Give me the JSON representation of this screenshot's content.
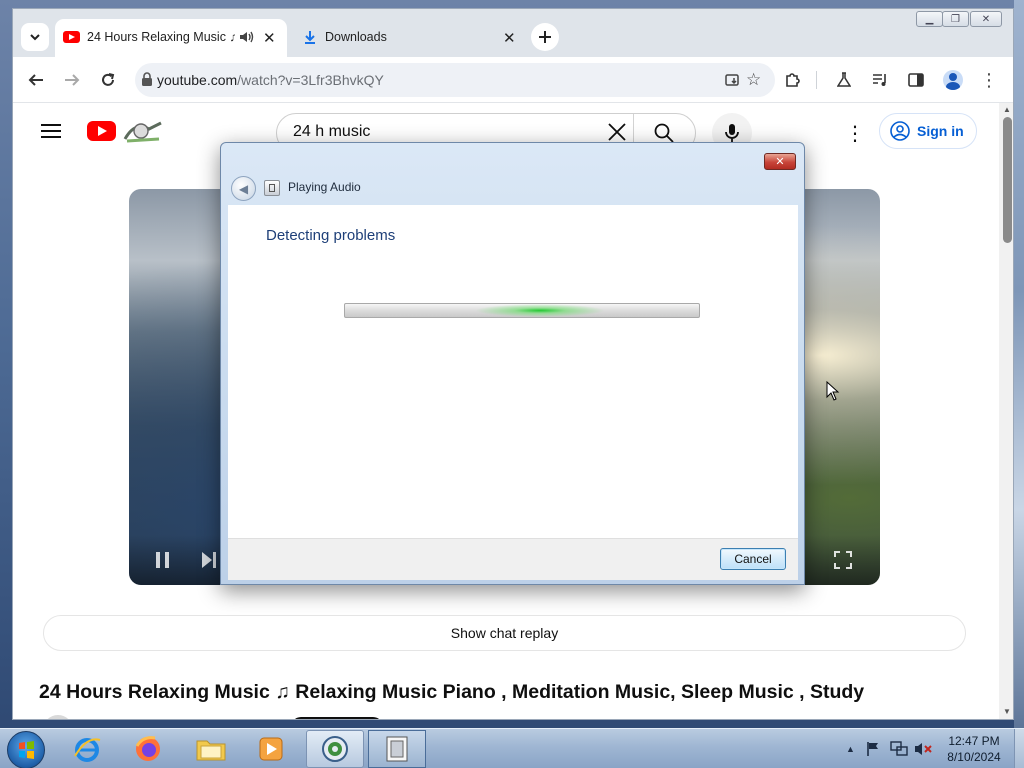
{
  "browser": {
    "tabs": [
      {
        "title": "24 Hours Relaxing Music ♫",
        "active": true,
        "favicon": "youtube-icon",
        "audio": "speaker-icon"
      },
      {
        "title": "Downloads",
        "active": false,
        "favicon": "download-icon"
      }
    ],
    "url_host": "youtube.com",
    "url_path": "/watch?v=3Lfr3BhvkQY"
  },
  "youtube": {
    "search_query": "24 h music",
    "signin_label": "Sign in",
    "chat_replay_label": "Show chat replay",
    "video_title": "24 Hours Relaxing Music ♫ Relaxing Music Piano , Meditation Music, Sleep Music , Study"
  },
  "dialog": {
    "title": "Playing Audio",
    "heading": "Detecting problems",
    "cancel_label": "Cancel",
    "progress_state": "indeterminate"
  },
  "taskbar": {
    "time": "12:47 PM",
    "date": "8/10/2024",
    "pinned": [
      "internet-explorer-icon",
      "firefox-icon",
      "file-explorer-icon",
      "media-player-icon",
      "troubleshooter-icon",
      "troubleshooter-window-icon"
    ]
  },
  "colors": {
    "youtube_red": "#ff0000",
    "signin_blue": "#065fd4",
    "dialog_heading": "#1e3f78",
    "progress_glow": "#18c828"
  }
}
